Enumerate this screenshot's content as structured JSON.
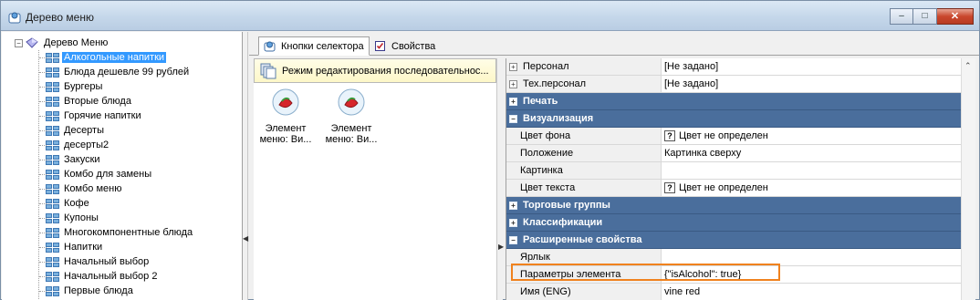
{
  "window": {
    "title": "Дерево меню",
    "buttons": {
      "minimize": "–",
      "maximize": "□",
      "close": "✕"
    }
  },
  "tree": {
    "root": "Дерево Меню",
    "root_expander": "−",
    "items": [
      "Алкогольные напитки",
      "Блюда дешевле 99 рублей",
      "Бургеры",
      "Вторые блюда",
      "Горячие напитки",
      "Десерты",
      "десерты2",
      "Закуски",
      "Комбо для замены",
      "Комбо меню",
      "Кофе",
      "Купоны",
      "Многокомпонентные блюда",
      "Напитки",
      "Начальный выбор",
      "Начальный выбор 2",
      "Первые блюда"
    ],
    "selected_index": 0
  },
  "tabs": [
    {
      "label": "Кнопки селектора",
      "active": true
    },
    {
      "label": "Свойства",
      "active": false
    }
  ],
  "sequence": {
    "header": "Режим редактирования последовательнос...",
    "elements": [
      {
        "line1": "Элемент",
        "line2": "меню: Ви..."
      },
      {
        "line1": "Элемент",
        "line2": "меню: Ви..."
      }
    ]
  },
  "properties": {
    "rows": [
      {
        "kind": "prop",
        "name": "Персонал",
        "value": "[Не задано]",
        "expander": "+"
      },
      {
        "kind": "prop",
        "name": "Тех.персонал",
        "value": "[Не задано]",
        "expander": "+"
      },
      {
        "kind": "category",
        "name": "Печать",
        "expander": "+"
      },
      {
        "kind": "category",
        "name": "Визуализация",
        "expander": "−"
      },
      {
        "kind": "prop",
        "name": "Цвет фона",
        "value": "Цвет не определен",
        "qmark": "?"
      },
      {
        "kind": "prop",
        "name": "Положение",
        "value": "Картинка сверху"
      },
      {
        "kind": "prop",
        "name": "Картинка",
        "value": ""
      },
      {
        "kind": "prop",
        "name": "Цвет текста",
        "value": "Цвет не определен",
        "qmark": "?"
      },
      {
        "kind": "category",
        "name": "Торговые группы",
        "expander": "+"
      },
      {
        "kind": "category",
        "name": "Классификации",
        "expander": "+"
      },
      {
        "kind": "category",
        "name": "Расширенные свойства",
        "expander": "−"
      },
      {
        "kind": "prop",
        "name": "Ярлык",
        "value": ""
      },
      {
        "kind": "prop",
        "name": "Параметры элемента",
        "value": "{\"isAlcohol\": true}"
      },
      {
        "kind": "prop",
        "name": "Имя (ENG)",
        "value": "vine red"
      }
    ]
  },
  "colors": {
    "category_bg": "#4a6e9c",
    "selection": "#3399ff",
    "highlight_border": "#f0821e"
  }
}
